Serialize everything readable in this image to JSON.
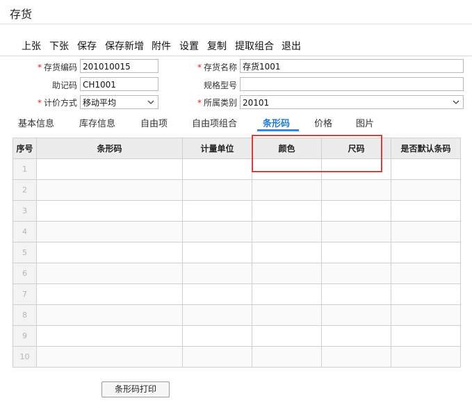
{
  "window": {
    "title": "存货"
  },
  "toolbar": {
    "items": [
      "上张",
      "下张",
      "保存",
      "保存新增",
      "附件",
      "设置",
      "复制",
      "提取组合",
      "退出"
    ]
  },
  "form": {
    "code_label": "存货编码",
    "code_value": "201010015",
    "name_label": "存货名称",
    "name_value": "存货1001",
    "mnemonic_label": "助记码",
    "mnemonic_value": "CH1001",
    "spec_label": "规格型号",
    "spec_value": "",
    "pricing_label": "计价方式",
    "pricing_value": "移动平均",
    "category_label": "所属类别",
    "category_value": "20101"
  },
  "tabs": [
    "基本信息",
    "库存信息",
    "自由项",
    "自由项组合",
    "条形码",
    "价格",
    "图片"
  ],
  "active_tab": "条形码",
  "grid": {
    "columns": [
      "序号",
      "条形码",
      "计量单位",
      "颜色",
      "尺码",
      "是否默认条码"
    ],
    "row_numbers": [
      "1",
      "2",
      "3",
      "4",
      "5",
      "6",
      "7",
      "8",
      "9",
      "10"
    ]
  },
  "footer": {
    "print_button": "条形码打印"
  },
  "colors": {
    "highlight": "#e03c3c",
    "active_tab": "#1f7bd8",
    "required_mark": "#e02020"
  }
}
